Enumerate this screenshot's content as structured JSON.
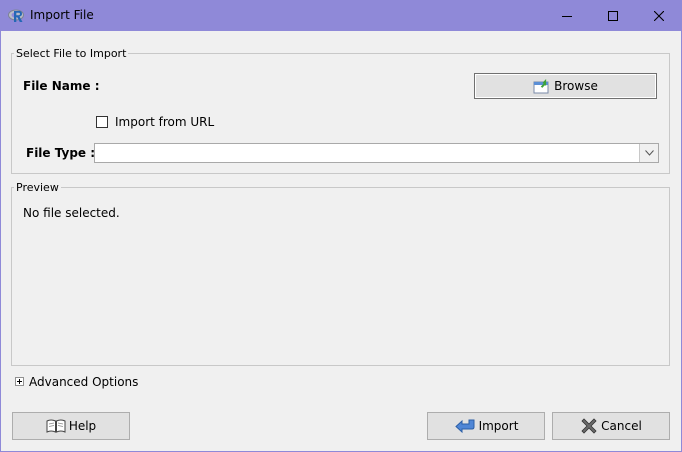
{
  "window": {
    "title": "Import File",
    "minimize_label": "Minimize",
    "maximize_label": "Maximize",
    "close_label": "Close"
  },
  "select_group": {
    "legend": "Select File to Import",
    "file_name_label": "File Name :",
    "browse_label": "Browse",
    "import_url_label": "Import from URL",
    "import_url_checked": false,
    "file_type_label": "File Type :",
    "file_type_value": ""
  },
  "preview_group": {
    "legend": "Preview",
    "message": "No file selected."
  },
  "advanced": {
    "label": "Advanced Options",
    "expanded": false
  },
  "buttons": {
    "help": "Help",
    "import": "Import",
    "cancel": "Cancel"
  },
  "colors": {
    "titlebar": "#8f89d8",
    "background": "#f0f0f0",
    "button_face": "#e1e1e1"
  }
}
